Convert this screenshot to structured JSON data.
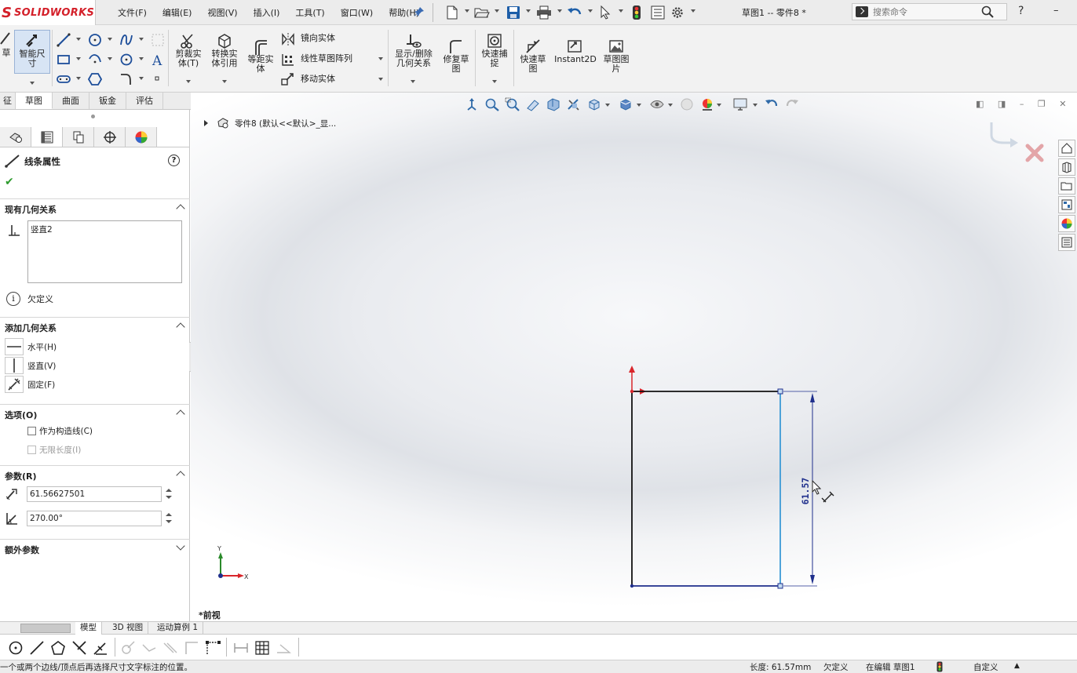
{
  "app": {
    "logo_text": "SOLIDWORKS",
    "document_title": "草图1 -- 零件8 *"
  },
  "menu": [
    "文件(F)",
    "编辑(E)",
    "视图(V)",
    "插入(I)",
    "工具(T)",
    "窗口(W)",
    "帮助(H)"
  ],
  "search": {
    "placeholder": "搜索命令"
  },
  "toolbar": {
    "partial_left_label": "草",
    "partial_left_label2": "",
    "smart_dim_label1": "智能尺",
    "smart_dim_label2": "寸",
    "trim_label1": "剪裁实",
    "trim_label2": "体(T)",
    "convert_label1": "转换实",
    "convert_label2": "体引用",
    "offset_label1": "等距实",
    "offset_label2": "体",
    "mirror_label": "镜向实体",
    "linear_pattern_label": "线性草图阵列",
    "move_label": "移动实体",
    "display_relations_label1": "显示/删除",
    "display_relations_label2": "几何关系",
    "repair_label1": "修复草",
    "repair_label2": "图",
    "quick_snap_label1": "快速捕",
    "quick_snap_label2": "捉",
    "rapid_sketch_label1": "快速草",
    "rapid_sketch_label2": "图",
    "instant2d_label": "Instant2D",
    "sketch_picture_label1": "草图图",
    "sketch_picture_label2": "片"
  },
  "cmd_tabs": [
    {
      "label": "征",
      "active": false
    },
    {
      "label": "草图",
      "active": true
    },
    {
      "label": "曲面",
      "active": false
    },
    {
      "label": "钣金",
      "active": false
    },
    {
      "label": "评估",
      "active": false
    }
  ],
  "property_manager": {
    "title": "线条属性",
    "existing_relations": {
      "title": "现有几何关系",
      "items": [
        "竖直2"
      ],
      "status": "欠定义"
    },
    "add_relations": {
      "title": "添加几何关系",
      "items": [
        "水平(H)",
        "竖直(V)",
        "固定(F)"
      ]
    },
    "options": {
      "title": "选项(O)",
      "construction": "作为构造线(C)",
      "infinite": "无限长度(I)"
    },
    "parameters": {
      "title": "参数(R)",
      "length": "61.56627501",
      "angle": "270.00°"
    },
    "extra": {
      "title": "额外参数"
    }
  },
  "graphics": {
    "tree_item": "零件8  (默认<<默认>_显...",
    "view_name": "*前视",
    "dimension_value": "61.57",
    "axis_x": "X",
    "axis_y": "Y"
  },
  "bottom_tabs": [
    "模型",
    "3D 视图",
    "运动算例 1"
  ],
  "status": {
    "prompt": "一个或两个边线/顶点后再选择尺寸文字标注的位置。",
    "length": "长度: 61.57mm",
    "definition": "欠定义",
    "editing": "在编辑 草图1",
    "units": "自定义"
  },
  "colors": {
    "accent_blue": "#1f3a93",
    "selected_line": "#3c9ad6",
    "origin_red": "#d9262b",
    "brand_red": "#d4202a"
  }
}
